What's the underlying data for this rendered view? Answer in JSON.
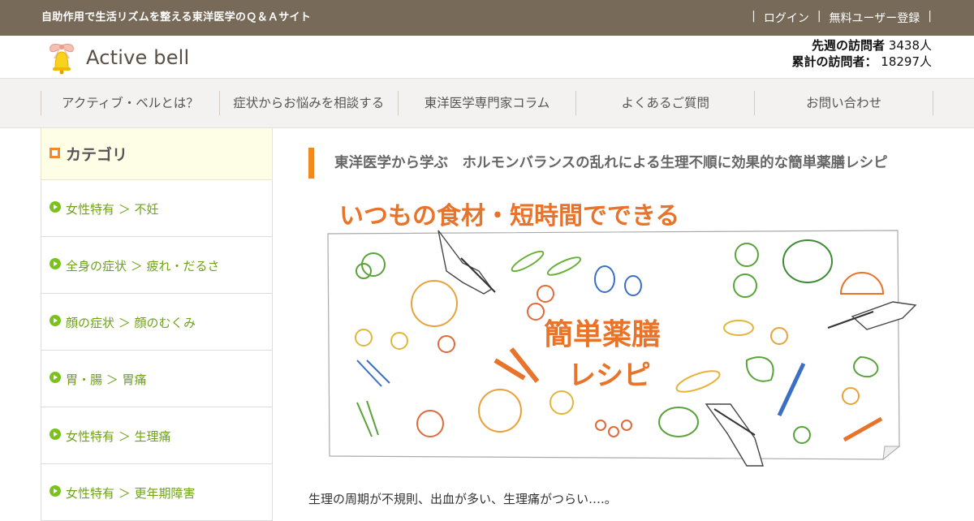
{
  "topbar": {
    "tagline": "自助作用で生活リズムを整える東洋医学のＱ＆Ａサイト",
    "sep": "|",
    "login": "ログイン",
    "register": "無料ユーザー登録"
  },
  "header": {
    "logo_text": "Active bell",
    "visitors_week_label": "先週の訪問者",
    "visitors_week_value": "3438人",
    "visitors_total_label": "累計の訪問者：",
    "visitors_total_value": "18297人"
  },
  "nav": {
    "items": [
      {
        "label": "アクティブ・ベルとは？"
      },
      {
        "label": "症状からお悩みを相談する"
      },
      {
        "label": "東洋医学専門家コラム"
      },
      {
        "label": "よくあるご質問"
      },
      {
        "label": "お問い合わせ"
      }
    ]
  },
  "sidebar": {
    "title": "カテゴリ",
    "items": [
      {
        "label": "女性特有 ＞ 不妊"
      },
      {
        "label": "全身の症状 ＞ 疲れ・だるさ"
      },
      {
        "label": "顔の症状 ＞ 顔のむくみ"
      },
      {
        "label": "胃・腸 ＞ 胃痛"
      },
      {
        "label": "女性特有 ＞ 生理痛"
      },
      {
        "label": "女性特有 ＞ 更年期障害"
      }
    ]
  },
  "main": {
    "title": "東洋医学から学ぶ　ホルモンバランスの乱れによる生理不順に効果的な簡単薬膳レシピ",
    "hero_headline": "いつもの食材・短時間でできる",
    "hero_center_1": "簡単薬膳",
    "hero_center_2": "レシピ",
    "lead": "生理の周期が不規則、出血が多い、生理痛がつらい….。"
  },
  "colors": {
    "topbar_bg": "#786a58",
    "accent_orange": "#f08a1a",
    "category_green": "#7cc21e",
    "hero_text": "#e8732a"
  }
}
